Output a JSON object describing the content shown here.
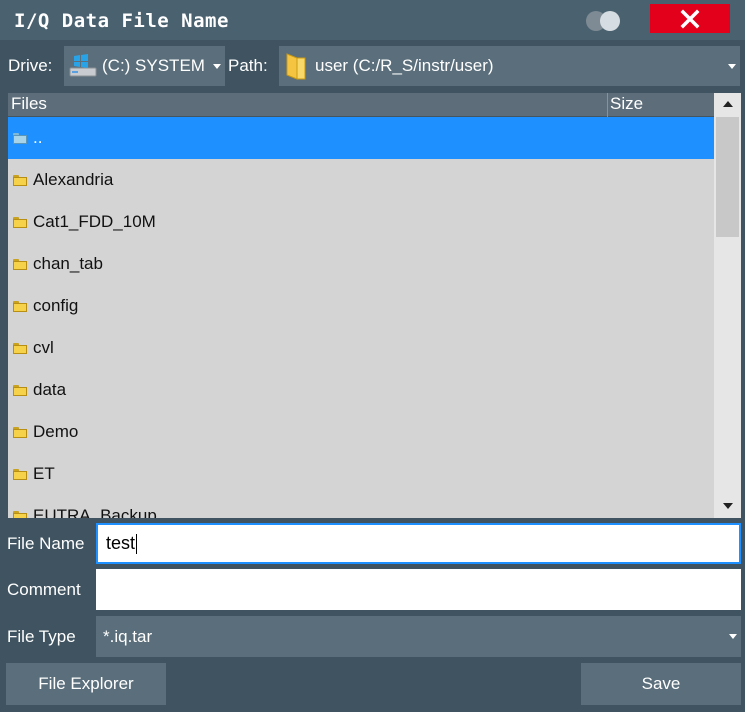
{
  "dialog": {
    "title": "I/Q Data File Name"
  },
  "drive": {
    "label": "Drive:",
    "value": "(C:) SYSTEM"
  },
  "path": {
    "label": "Path:",
    "value": "user (C:/R_S/instr/user)"
  },
  "filelist": {
    "columns": [
      "Files",
      "Size"
    ],
    "rows": [
      {
        "name": "..",
        "selected": true,
        "icon": "folder-up-icon"
      },
      {
        "name": "Alexandria",
        "icon": "folder-icon"
      },
      {
        "name": "Cat1_FDD_10M",
        "icon": "folder-icon"
      },
      {
        "name": "chan_tab",
        "icon": "folder-icon"
      },
      {
        "name": "config",
        "icon": "folder-icon"
      },
      {
        "name": "cvl",
        "icon": "folder-icon"
      },
      {
        "name": "data",
        "icon": "folder-icon"
      },
      {
        "name": "Demo",
        "icon": "folder-icon"
      },
      {
        "name": "ET",
        "icon": "folder-icon"
      },
      {
        "name": "EUTRA_Backup",
        "icon": "folder-icon"
      }
    ]
  },
  "fields": {
    "file_name_label": "File Name",
    "file_name_value": "test",
    "comment_label": "Comment",
    "comment_value": "",
    "file_type_label": "File Type",
    "file_type_value": "*.iq.tar"
  },
  "buttons": {
    "file_explorer": "File Explorer",
    "save": "Save"
  },
  "colors": {
    "dialog_bg": "#3f5361",
    "close_button": "#e3001b",
    "selection": "#1e90ff",
    "list_bg": "#d4d4d4"
  }
}
